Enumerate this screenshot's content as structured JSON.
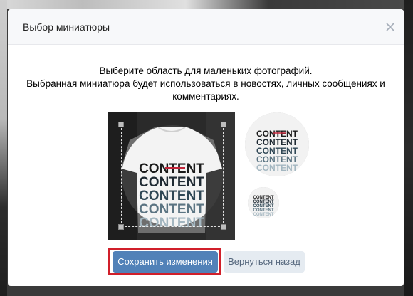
{
  "modal": {
    "title": "Выбор миниатюры",
    "close_icon": "close-icon"
  },
  "instructions": {
    "line1": "Выберите область для маленьких фотографий.",
    "line2": "Выбранная миниатюра будет использоваться в новостях, личных сообщениях и",
    "line3": "комментариях."
  },
  "photo": {
    "shirt_text": [
      "CONTENT",
      "CONTENT",
      "CONTENT",
      "CONTENT",
      "CONTENT"
    ]
  },
  "buttons": {
    "save_label": "Сохранить изменения",
    "back_label": "Вернуться назад"
  },
  "colors": {
    "primary": "#5181b8",
    "highlight": "#d11f2a",
    "secondary_bg": "#e5ebf1"
  }
}
